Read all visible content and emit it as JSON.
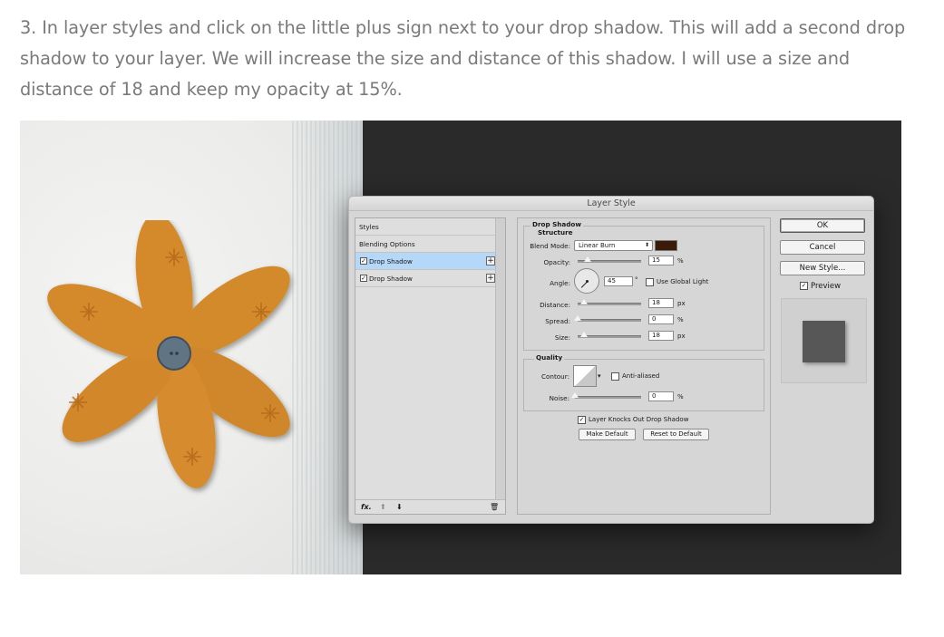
{
  "instruction": {
    "text": "3. In layer styles and click on the little plus sign next to your drop shadow. This will add a second drop shadow to your layer. We will increase the size and distance of this shadow. I will use a size and distance of 18 and keep my opacity at 15%."
  },
  "dialog": {
    "title": "Layer Style",
    "left_panel": {
      "styles_label": "Styles",
      "blending_label": "Blending Options",
      "items": [
        {
          "label": "Drop Shadow",
          "checked": true,
          "selected": true
        },
        {
          "label": "Drop Shadow",
          "checked": true,
          "selected": false
        }
      ],
      "check_glyph": "✓",
      "plus_glyph": "+",
      "footer": {
        "fx": "fx.",
        "up": "⬆",
        "down": "⬇",
        "trash": "🗑"
      }
    },
    "drop_shadow": {
      "title": "Drop Shadow",
      "structure": "Structure",
      "blend_mode_label": "Blend Mode:",
      "blend_mode_value": "Linear Burn",
      "select_arrow": "⬍",
      "shadow_color": "#3a1a08",
      "opacity_label": "Opacity:",
      "opacity_value": "15",
      "opacity_pct": 15,
      "percent": "%",
      "angle_label": "Angle:",
      "angle_value": "45",
      "degree": "°",
      "use_global_light": "Use Global Light",
      "distance_label": "Distance:",
      "distance_value": "18",
      "distance_level": 0.1,
      "spread_label": "Spread:",
      "spread_value": "0",
      "spread_pct": 0,
      "size_label": "Size:",
      "size_value": "18",
      "size_level": 0.1,
      "px": "px"
    },
    "quality": {
      "title": "Quality",
      "contour_label": "Contour:",
      "anti_aliased": "Anti-aliased",
      "noise_label": "Noise:",
      "noise_value": "0",
      "noise_pct": 0,
      "percent": "%"
    },
    "knockout_label": "Layer Knocks Out Drop Shadow",
    "make_default": "Make Default",
    "reset_default": "Reset to Default",
    "buttons": {
      "ok": "OK",
      "cancel": "Cancel",
      "new_style": "New Style...",
      "preview": "Preview"
    }
  },
  "colors": {
    "text": "#7a7a7a",
    "flower": "#d98e2e",
    "button": "#5f7585",
    "dark_bg": "#2a2a2a",
    "selection": "#b5d7f8"
  }
}
